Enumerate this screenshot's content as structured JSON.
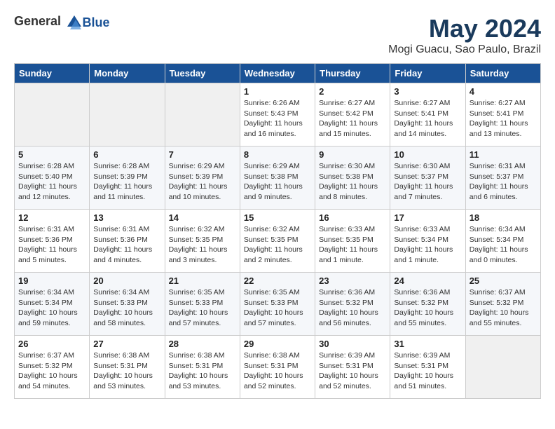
{
  "logo": {
    "text_general": "General",
    "text_blue": "Blue"
  },
  "title": {
    "month": "May 2024",
    "location": "Mogi Guacu, Sao Paulo, Brazil"
  },
  "days_of_week": [
    "Sunday",
    "Monday",
    "Tuesday",
    "Wednesday",
    "Thursday",
    "Friday",
    "Saturday"
  ],
  "weeks": [
    [
      {
        "day": "",
        "info": ""
      },
      {
        "day": "",
        "info": ""
      },
      {
        "day": "",
        "info": ""
      },
      {
        "day": "1",
        "info": "Sunrise: 6:26 AM\nSunset: 5:43 PM\nDaylight: 11 hours\nand 16 minutes."
      },
      {
        "day": "2",
        "info": "Sunrise: 6:27 AM\nSunset: 5:42 PM\nDaylight: 11 hours\nand 15 minutes."
      },
      {
        "day": "3",
        "info": "Sunrise: 6:27 AM\nSunset: 5:41 PM\nDaylight: 11 hours\nand 14 minutes."
      },
      {
        "day": "4",
        "info": "Sunrise: 6:27 AM\nSunset: 5:41 PM\nDaylight: 11 hours\nand 13 minutes."
      }
    ],
    [
      {
        "day": "5",
        "info": "Sunrise: 6:28 AM\nSunset: 5:40 PM\nDaylight: 11 hours\nand 12 minutes."
      },
      {
        "day": "6",
        "info": "Sunrise: 6:28 AM\nSunset: 5:39 PM\nDaylight: 11 hours\nand 11 minutes."
      },
      {
        "day": "7",
        "info": "Sunrise: 6:29 AM\nSunset: 5:39 PM\nDaylight: 11 hours\nand 10 minutes."
      },
      {
        "day": "8",
        "info": "Sunrise: 6:29 AM\nSunset: 5:38 PM\nDaylight: 11 hours\nand 9 minutes."
      },
      {
        "day": "9",
        "info": "Sunrise: 6:30 AM\nSunset: 5:38 PM\nDaylight: 11 hours\nand 8 minutes."
      },
      {
        "day": "10",
        "info": "Sunrise: 6:30 AM\nSunset: 5:37 PM\nDaylight: 11 hours\nand 7 minutes."
      },
      {
        "day": "11",
        "info": "Sunrise: 6:31 AM\nSunset: 5:37 PM\nDaylight: 11 hours\nand 6 minutes."
      }
    ],
    [
      {
        "day": "12",
        "info": "Sunrise: 6:31 AM\nSunset: 5:36 PM\nDaylight: 11 hours\nand 5 minutes."
      },
      {
        "day": "13",
        "info": "Sunrise: 6:31 AM\nSunset: 5:36 PM\nDaylight: 11 hours\nand 4 minutes."
      },
      {
        "day": "14",
        "info": "Sunrise: 6:32 AM\nSunset: 5:35 PM\nDaylight: 11 hours\nand 3 minutes."
      },
      {
        "day": "15",
        "info": "Sunrise: 6:32 AM\nSunset: 5:35 PM\nDaylight: 11 hours\nand 2 minutes."
      },
      {
        "day": "16",
        "info": "Sunrise: 6:33 AM\nSunset: 5:35 PM\nDaylight: 11 hours\nand 1 minute."
      },
      {
        "day": "17",
        "info": "Sunrise: 6:33 AM\nSunset: 5:34 PM\nDaylight: 11 hours\nand 1 minute."
      },
      {
        "day": "18",
        "info": "Sunrise: 6:34 AM\nSunset: 5:34 PM\nDaylight: 11 hours\nand 0 minutes."
      }
    ],
    [
      {
        "day": "19",
        "info": "Sunrise: 6:34 AM\nSunset: 5:34 PM\nDaylight: 10 hours\nand 59 minutes."
      },
      {
        "day": "20",
        "info": "Sunrise: 6:34 AM\nSunset: 5:33 PM\nDaylight: 10 hours\nand 58 minutes."
      },
      {
        "day": "21",
        "info": "Sunrise: 6:35 AM\nSunset: 5:33 PM\nDaylight: 10 hours\nand 57 minutes."
      },
      {
        "day": "22",
        "info": "Sunrise: 6:35 AM\nSunset: 5:33 PM\nDaylight: 10 hours\nand 57 minutes."
      },
      {
        "day": "23",
        "info": "Sunrise: 6:36 AM\nSunset: 5:32 PM\nDaylight: 10 hours\nand 56 minutes."
      },
      {
        "day": "24",
        "info": "Sunrise: 6:36 AM\nSunset: 5:32 PM\nDaylight: 10 hours\nand 55 minutes."
      },
      {
        "day": "25",
        "info": "Sunrise: 6:37 AM\nSunset: 5:32 PM\nDaylight: 10 hours\nand 55 minutes."
      }
    ],
    [
      {
        "day": "26",
        "info": "Sunrise: 6:37 AM\nSunset: 5:32 PM\nDaylight: 10 hours\nand 54 minutes."
      },
      {
        "day": "27",
        "info": "Sunrise: 6:38 AM\nSunset: 5:31 PM\nDaylight: 10 hours\nand 53 minutes."
      },
      {
        "day": "28",
        "info": "Sunrise: 6:38 AM\nSunset: 5:31 PM\nDaylight: 10 hours\nand 53 minutes."
      },
      {
        "day": "29",
        "info": "Sunrise: 6:38 AM\nSunset: 5:31 PM\nDaylight: 10 hours\nand 52 minutes."
      },
      {
        "day": "30",
        "info": "Sunrise: 6:39 AM\nSunset: 5:31 PM\nDaylight: 10 hours\nand 52 minutes."
      },
      {
        "day": "31",
        "info": "Sunrise: 6:39 AM\nSunset: 5:31 PM\nDaylight: 10 hours\nand 51 minutes."
      },
      {
        "day": "",
        "info": ""
      }
    ]
  ]
}
